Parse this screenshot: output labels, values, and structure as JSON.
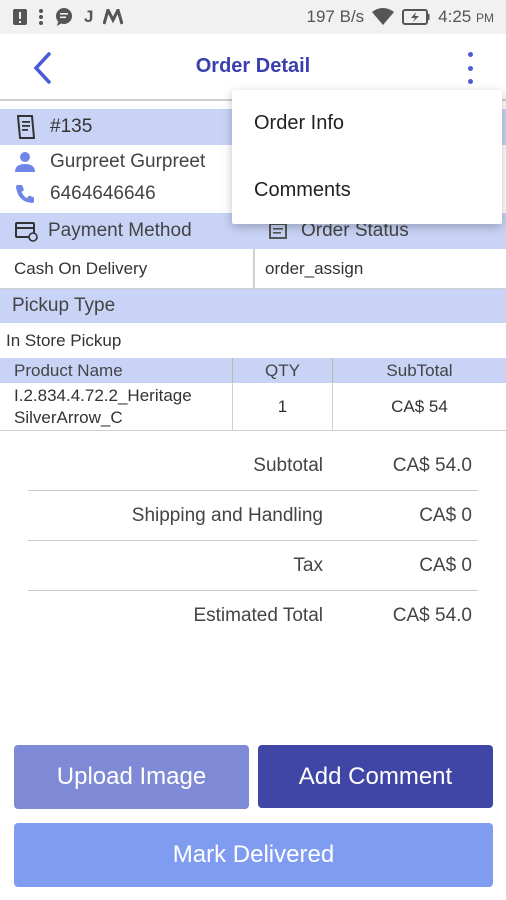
{
  "status_bar": {
    "net_speed": "197 B/s",
    "time": "4:25",
    "ampm": "PM",
    "icons": [
      "alert-icon",
      "more-vert-icon",
      "chat-icon",
      "j-app-icon",
      "m-app-icon",
      "wifi-icon",
      "battery-icon"
    ]
  },
  "header": {
    "title": "Order Detail"
  },
  "order": {
    "number": "#135",
    "customer_name": "Gurpreet Gurpreet",
    "phone": "6464646646"
  },
  "payment": {
    "method_label": "Payment Method",
    "status_label": "Order Status",
    "method_value": "Cash On Delivery",
    "status_value": "order_assign"
  },
  "pickup": {
    "label": "Pickup Type",
    "value": "In Store Pickup"
  },
  "products": {
    "headers": [
      "Product Name",
      "QTY",
      "SubTotal"
    ],
    "rows": [
      {
        "name_line1": "I.2.834.4.72.2_Heritage",
        "name_line2": "SilverArrow_C",
        "qty": "1",
        "subtotal": "CA$ 54"
      }
    ]
  },
  "totals": [
    {
      "label": "Subtotal",
      "value": "CA$ 54.0"
    },
    {
      "label": "Shipping and Handling",
      "value": "CA$ 0"
    },
    {
      "label": "Tax",
      "value": "CA$ 0"
    },
    {
      "label": "Estimated Total",
      "value": "CA$ 54.0"
    }
  ],
  "buttons": {
    "upload_image": "Upload Image",
    "add_comment": "Add Comment",
    "mark_delivered": "Mark Delivered"
  },
  "menu": {
    "items": [
      "Order Info",
      "Comments"
    ]
  },
  "colors": {
    "accent": "#3a3fb0",
    "band": "#c8d3f6",
    "upload_button": "#7f8ad6",
    "comment_button": "#3f46a6",
    "deliver_button": "#7f9cf0"
  }
}
